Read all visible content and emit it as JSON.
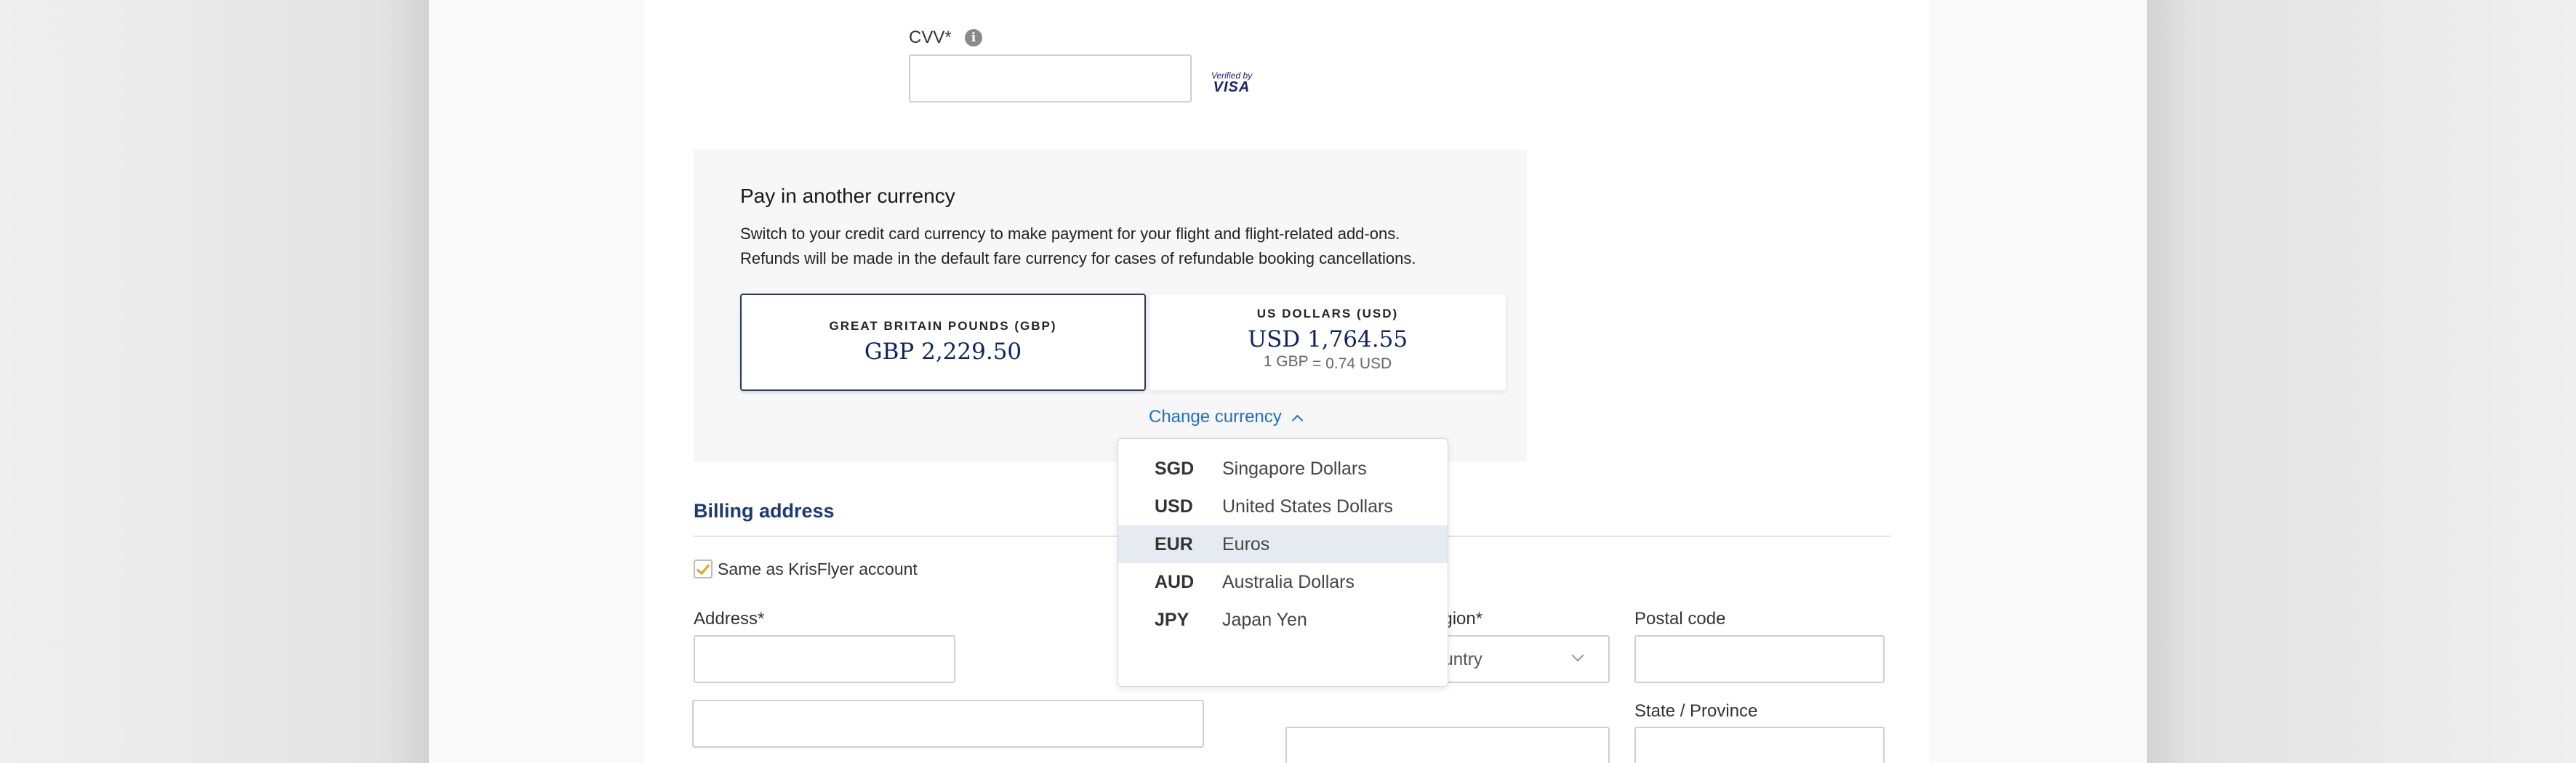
{
  "cvv": {
    "label": "CVV*",
    "info_icon_glyph": "i",
    "badge_top": "Verified by",
    "badge_bottom": "VISA"
  },
  "currency_panel": {
    "title": "Pay in another currency",
    "description_line1": "Switch to your credit card currency to make payment for your flight and flight-related add-ons.",
    "description_line2": "Refunds will be made in the default fare currency for cases of refundable booking cancellations.",
    "options": [
      {
        "name": "GREAT BRITAIN POUNDS (GBP)",
        "amount": "GBP 2,229.50",
        "selected": true
      },
      {
        "name": "US DOLLARS (USD)",
        "amount": "USD 1,764.55",
        "rate_left": "1 GBP",
        "rate_right": "= 0.74 USD",
        "selected": false
      }
    ],
    "change_currency_label": "Change currency"
  },
  "currency_dropdown": {
    "items": [
      {
        "code": "SGD",
        "name": "Singapore Dollars"
      },
      {
        "code": "USD",
        "name": "United States Dollars"
      },
      {
        "code": "EUR",
        "name": "Euros",
        "highlighted": true
      },
      {
        "code": "AUD",
        "name": "Australia Dollars"
      },
      {
        "code": "JPY",
        "name": "Japan Yen"
      }
    ]
  },
  "billing": {
    "title": "Billing address",
    "same_as_label": "Same as KrisFlyer account",
    "same_as_checked": true,
    "address_label": "Address*",
    "region_label_fragment": "egion*",
    "region_value_fragment": "ountry",
    "postal_label": "Postal code",
    "state_label": "State / Province"
  },
  "colors": {
    "brand_navy": "#0e2463",
    "link_blue": "#1a6fd1",
    "section_blue": "#1b3a7a",
    "checkmark_gold": "#e8a21a",
    "highlight_row": "#e6ebf2"
  }
}
